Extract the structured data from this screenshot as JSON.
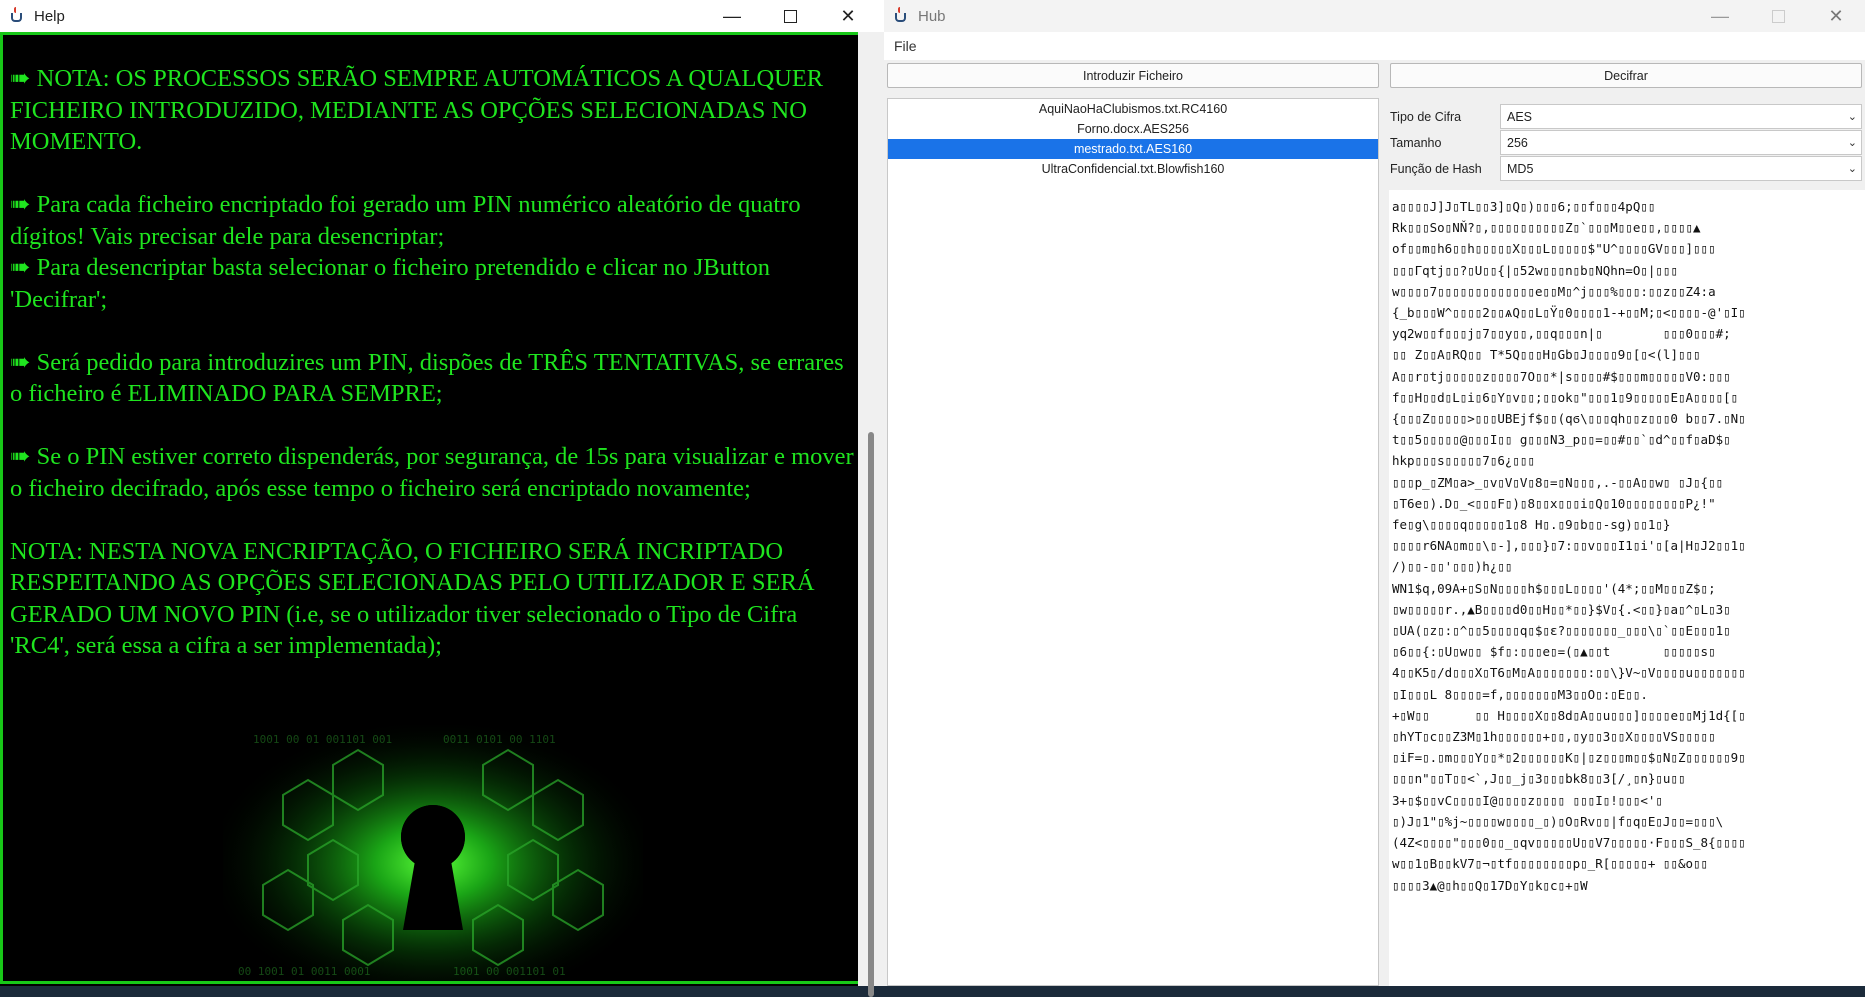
{
  "help_window": {
    "title": "Help",
    "paragraphs": [
      "➠ NOTA: OS PROCESSOS SERÃO SEMPRE AUTOMÁTICOS A QUALQUER FICHEIRO INTRODUZIDO, MEDIANTE AS OPÇÕES SELECIONADAS NO MOMENTO.",
      "➠ Para cada ficheiro encriptado foi gerado um PIN numérico aleatório de quatro dígitos! Vais precisar dele para desencriptar;\n➠ Para desencriptar basta selecionar o ficheiro pretendido e clicar no JButton 'Decifrar';",
      "➠ Será pedido para introduzires um PIN, dispões de TRÊS TENTATIVAS, se errares o ficheiro é ELIMINADO PARA SEMPRE;",
      "➠ Se o PIN estiver correto dispenderás, por segurança, de 15s para visualizar e mover o ficheiro decifrado, após esse tempo o ficheiro será encriptado novamente;",
      "NOTA: NESTA NOVA ENCRIPTAÇÃO, O FICHEIRO SERÁ INCRIPTADO RESPEITANDO AS OPÇÕES SELECIONADAS PELO UTILIZADOR E SERÁ GERADO UM NOVO PIN (i.e, se o utilizador tiver selecionado o Tipo de Cifra 'RC4', será essa a cifra a ser implementada);"
    ],
    "accent_color": "#1fe51f",
    "image_icon": "keyhole-circuit-icon"
  },
  "hub_window": {
    "title": "Hub",
    "menu": [
      "File"
    ],
    "buttons": {
      "introduce": "Introduzir Ficheiro",
      "decipher": "Decifrar"
    },
    "files": [
      "AquiNaoHaClubismos.txt.RC4160",
      "Forno.docx.AES256",
      "mestrado.txt.AES160",
      "UltraConfidencial.txt.Blowfish160"
    ],
    "selected_file": "mestrado.txt.AES160",
    "form": {
      "cipher_type_label": "Tipo de Cifra",
      "cipher_type_value": "AES",
      "size_label": "Tamanho",
      "size_value": "256",
      "hash_label": "Função de Hash",
      "hash_value": "MD5"
    },
    "cipher_text_lines": [
      "a▯▯▯▯J]J▯TL▯▯3]▯Q▯)▯▯▯6;▯▯f▯▯▯4pQ▯▯",
      "Rk▯▯▯So▯NŇ?▯,▯▯▯▯▯▯▯▯▯▯Z▯`▯▯▯M▯▯e▯▯,▯▯▯▯▲",
      "of▯▯m▯h6▯▯h▯▯▯▯▯X▯▯▯L▯▯▯▯▯$\"U^▯▯▯▯GV▯▯▯]▯▯▯",
      "▯▯▯Γqtj▯▯?▯U▯▯{|▯52w▯▯▯n▯b▯NQhn=O▯|▯▯▯",
      "w▯▯▯▯7▯▯▯▯▯▯▯▯▯▯▯▯▯e▯▯M▯^j▯▯▯%▯▯▯:▯▯z▯▯Z4:a",
      "{_b▯▯▯W^▯▯▯▯2▯▯ѧQ▯▯L▯Ÿ▯0▯▯▯▯1-+▯▯M;▯<▯▯▯▯-@'▯I▯",
      "yq2w▯▯f▯▯▯j▯7▯▯y▯▯,▯▯q▯▯▯n|▯        ▯▯▯0▯▯▯#;",
      "▯▯ Z▯▯A▯RQ▯▯ T*5Q▯▯▯H▯Gb▯J▯▯▯▯9▯[▯<(l]▯▯▯",
      "A▯▯r▯tj▯▯▯▯▯z▯▯▯▯7O▯▯*|s▯▯▯▯#$▯▯▯m▯▯▯▯▯V0:▯▯▯",
      "f▯▯H▯▯d▯L▯i▯6▯Y▯v▯▯;▯▯ok▯\"▯▯▯1▯9▯▯▯▯▯E▯A▯▯▯▯[▯",
      "{▯▯▯Z▯▯▯▯▯>▯▯▯UBEjf$▯▯(qϭ\\▯▯▯qh▯▯z▯▯▯0 b▯▯7.▯N▯",
      "t▯▯5▯▯▯▯▯@▯▯▯I▯▯ g▯▯▯N3_p▯▯=▯▯#▯▯`▯d^▯▯f▯aD$▯",
      "hkp▯▯▯s▯▯▯▯▯7▯6¿▯▯▯",
      "▯▯▯p_▯ZM▯a>_▯v▯V▯V▯8▯=▯N▯▯▯,.-▯▯A▯▯w▯ ▯J▯{▯▯",
      "▯T6e▯).D▯_<▯▯▯F▯)▯8▯▯x▯▯▯i▯Q▯10▯▯▯▯▯▯▯▯P¿!\"",
      "fe▯g\\▯▯▯▯q▯▯▯▯▯1▯8 H▯.▯9▯b▯▯-sg)▯▯1▯}",
      "▯▯▯▯r6NA▯m▯▯\\▯-],▯▯▯}▯7:▯▯v▯▯▯I1▯i'▯[a|H▯J2▯▯1▯",
      "/)▯▯-▯▯'▯▯▯)h¿▯▯",
      "WN1$q,09A+▯S▯N▯▯▯▯h$▯▯▯L▯▯▯▯'(4*;▯▯M▯▯▯Z$▯;",
      "▯w▯▯▯▯▯r.,▲B▯▯▯▯d0▯▯H▯▯*▯▯}$V▯{.<▯▯}▯a▯^▯L▯3▯",
      "▯UA(▯z▯:▯^▯▯5▯▯▯▯q▯$▯ε?▯▯▯▯▯▯▯_▯▯▯\\▯`▯▯E▯▯▯1▯",
      "▯6▯▯{:▯U▯w▯▯ $f▯:▯▯▯e▯=(▯▲▯▯t       ▯▯▯▯▯s▯",
      "4▯▯K5▯/d▯▯▯X▯T6▯M▯A▯▯▯▯▯▯▯:▯▯\\}V~▯V▯▯▯▯u▯▯▯▯▯▯▯",
      "▯I▯▯▯L 8▯▯▯▯=f,▯▯▯▯▯▯▯M3▯▯O▯:▯E▯▯.",
      "+▯W▯▯      ▯▯ H▯▯▯▯X▯▯8d▯A▯▯u▯▯▯]▯▯▯▯e▯▯Mj1d{[▯",
      "▯hYT▯c▯▯Z3M▯1h▯▯▯▯▯▯+▯▯,▯y▯▯3▯▯X▯▯▯▯VS▯▯▯▯▯",
      "▯iF=▯.▯m▯▯▯Y▯▯*▯2▯▯▯▯▯▯K▯|▯z▯▯▯m▯▯$▯N▯Z▯▯▯▯▯▯9▯",
      "▯▯▯n\"▯▯T▯▯<`,J▯▯_j▯3▯▯▯bk8▯▯3[/¸▯n}▯u▯▯",
      "3+▯$▯▯vC▯▯▯▯I@▯▯▯▯z▯▯▯▯ ▯▯▯I▯!▯▯▯<'▯",
      "▯)J▯1\"▯%j~▯▯▯▯w▯▯▯▯_▯)▯O▯Rv▯▯|f▯q▯E▯J▯▯=▯▯▯\\",
      "(4Z<▯▯▯▯\"▯▯▯0▯▯_▯qv▯▯▯▯▯U▯▯V7▯▯▯▯▯·F▯▯▯S_8{▯▯▯▯",
      "w▯▯1▯B▯▯kV7▯¬▯tf▯▯▯▯▯▯▯▯p▯_R[▯▯▯▯▯+ ▯▯&o▯▯",
      "▯▯▯▯3▲@▯h▯▯Q▯17D▯Y▯k▯c▯+▯W"
    ],
    "selection_color": "#1a73e8"
  }
}
